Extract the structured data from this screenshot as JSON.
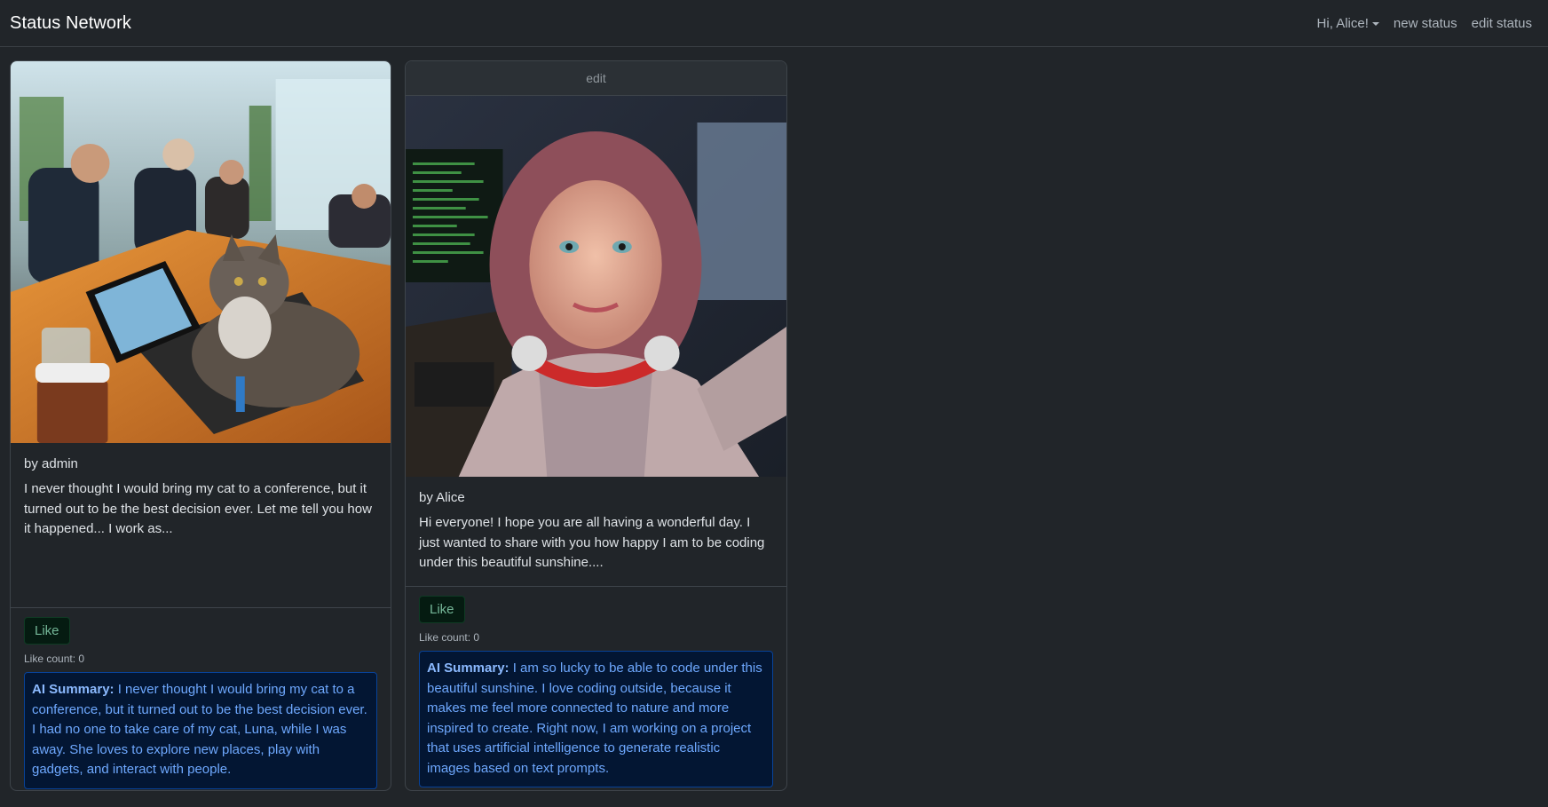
{
  "navbar": {
    "brand": "Status Network",
    "user_menu": "Hi, Alice!",
    "new_status": "new status",
    "edit_status": "edit status"
  },
  "posts": [
    {
      "header": "",
      "author": "by admin",
      "body": "I never thought I would bring my cat to a conference, but it turned out to be the best decision ever. Let me tell you how it happened... I work as...",
      "like_label": "Like",
      "like_count": "Like count: 0",
      "summary_label": "AI Summary:",
      "summary": "I never thought I would bring my cat to a conference, but it turned out to be the best decision ever. I had no one to take care of my cat, Luna, while I was away. She loves to explore new places, play with gadgets, and interact with people.",
      "image_alt": "cat sitting on a conference table"
    },
    {
      "header": "edit",
      "author": "by Alice",
      "body": "Hi everyone! I hope you are all having a wonderful day. I just wanted to share with you how happy I am to be coding under this beautiful sunshine....",
      "like_label": "Like",
      "like_count": "Like count: 0",
      "summary_label": "AI Summary:",
      "summary": "I am so lucky to be able to code under this beautiful sunshine. I love coding outside, because it makes me feel more connected to nature and more inspired to create. Right now, I am working on a project that uses artificial intelligence to generate realistic images based on text prompts.",
      "image_alt": "selfie of a woman with headphones in an office"
    }
  ],
  "colors": {
    "background": "#212529",
    "like_button_text": "#75b798",
    "summary_bg": "#031633",
    "summary_text": "#6ea8fe"
  }
}
